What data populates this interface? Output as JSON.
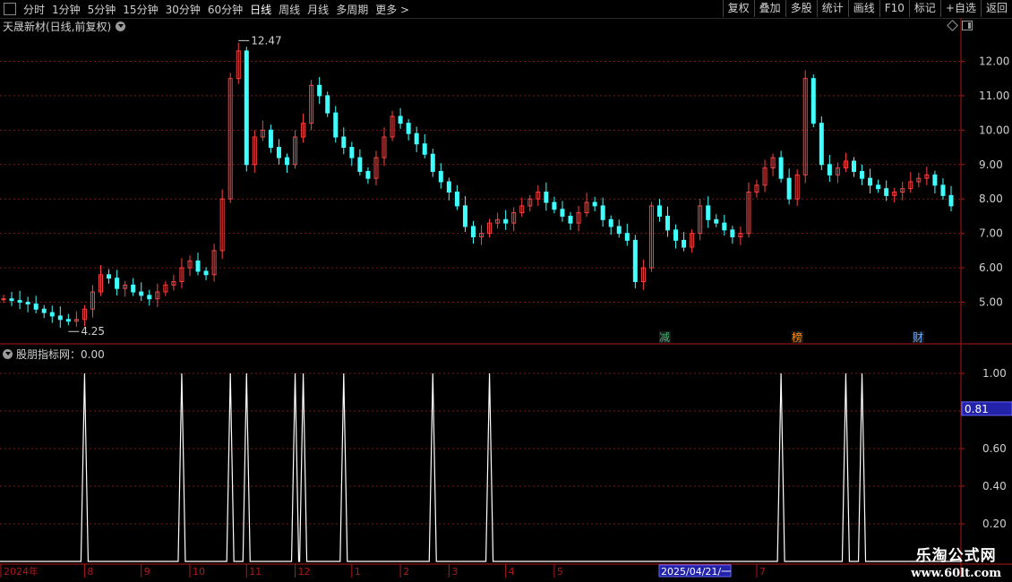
{
  "toolbar": {
    "periods": [
      "分时",
      "1分钟",
      "5分钟",
      "15分钟",
      "30分钟",
      "60分钟",
      "日线",
      "周线",
      "月线",
      "多周期",
      "更多 >"
    ],
    "active_period": "日线",
    "right_buttons": [
      "复权",
      "叠加",
      "多股",
      "统计",
      "画线",
      "F10",
      "标记",
      "+自选",
      "返回"
    ]
  },
  "main": {
    "title": "天晟新材(日线,前复权)",
    "high_label": "12.47",
    "low_label": "4.25",
    "markers": [
      {
        "text": "减",
        "color": "#3cb371",
        "after_date": "2025/04"
      },
      {
        "text": "榜",
        "color": "#ff8c00",
        "after_date": "2025/06"
      },
      {
        "text": "财",
        "color": "#6aa9ff",
        "after_date": "2025/07"
      }
    ]
  },
  "indicator": {
    "title": "股朋指标网：0.00",
    "cursor_value": "0.81"
  },
  "time_axis": {
    "cursor_date": "2025/04/21/一"
  },
  "colors": {
    "up": "#ff4040",
    "down": "#40ffff",
    "grid": "#7a1a1a",
    "axis": "#b01818",
    "cursor_bg": "#2222aa"
  },
  "chart_data": [
    {
      "type": "candlestick",
      "title": "天晟新材(日线,前复权)",
      "y_ticks": [
        5.0,
        6.0,
        7.0,
        8.0,
        9.0,
        10.0,
        11.0,
        12.0
      ],
      "ylim": [
        4.0,
        13.0
      ],
      "x_ticks": [
        "2024年",
        "8",
        "9",
        "10",
        "11",
        "12",
        "1",
        "2",
        "3",
        "4",
        "5",
        "6",
        "7"
      ],
      "annotations": [
        {
          "text": "12.47",
          "type": "high"
        },
        {
          "text": "4.25",
          "type": "low"
        }
      ],
      "close_series": [
        5.1,
        5.05,
        5.0,
        4.95,
        4.8,
        4.7,
        4.6,
        4.5,
        4.45,
        4.5,
        4.8,
        5.3,
        5.8,
        5.7,
        5.4,
        5.5,
        5.3,
        5.2,
        5.1,
        5.3,
        5.5,
        5.6,
        6.0,
        6.2,
        5.9,
        5.8,
        6.5,
        8.0,
        11.5,
        12.3,
        9.0,
        9.8,
        10.0,
        9.5,
        9.2,
        9.0,
        9.8,
        10.2,
        11.3,
        11.0,
        10.5,
        9.8,
        9.5,
        9.2,
        8.8,
        8.6,
        9.2,
        9.8,
        10.4,
        10.2,
        9.9,
        9.6,
        9.3,
        8.8,
        8.5,
        8.2,
        7.8,
        7.2,
        6.9,
        7.0,
        7.3,
        7.4,
        7.3,
        7.6,
        7.8,
        8.0,
        8.2,
        7.9,
        7.7,
        7.5,
        7.3,
        7.6,
        7.9,
        7.8,
        7.4,
        7.2,
        7.0,
        6.8,
        5.6,
        6.0,
        7.8,
        7.5,
        7.1,
        6.8,
        6.6,
        7.0,
        7.8,
        7.4,
        7.3,
        7.1,
        6.9,
        7.0,
        8.2,
        8.4,
        8.9,
        9.2,
        8.6,
        8.0,
        8.7,
        11.5,
        10.2,
        9.0,
        8.7,
        8.9,
        9.1,
        8.8,
        8.6,
        8.4,
        8.3,
        8.1,
        8.2,
        8.3,
        8.5,
        8.6,
        8.7,
        8.4,
        8.1,
        7.8
      ]
    },
    {
      "type": "line",
      "title": "股朋指标网",
      "y_ticks": [
        0.2,
        0.4,
        0.6,
        0.8,
        1.0
      ],
      "ylim": [
        0,
        1.1
      ],
      "spikes_at_candle_index": [
        10,
        22,
        28,
        30,
        36,
        37,
        42,
        53,
        60,
        96,
        104,
        106
      ],
      "baseline_value": 0.0,
      "peak_value": 1.0
    }
  ]
}
